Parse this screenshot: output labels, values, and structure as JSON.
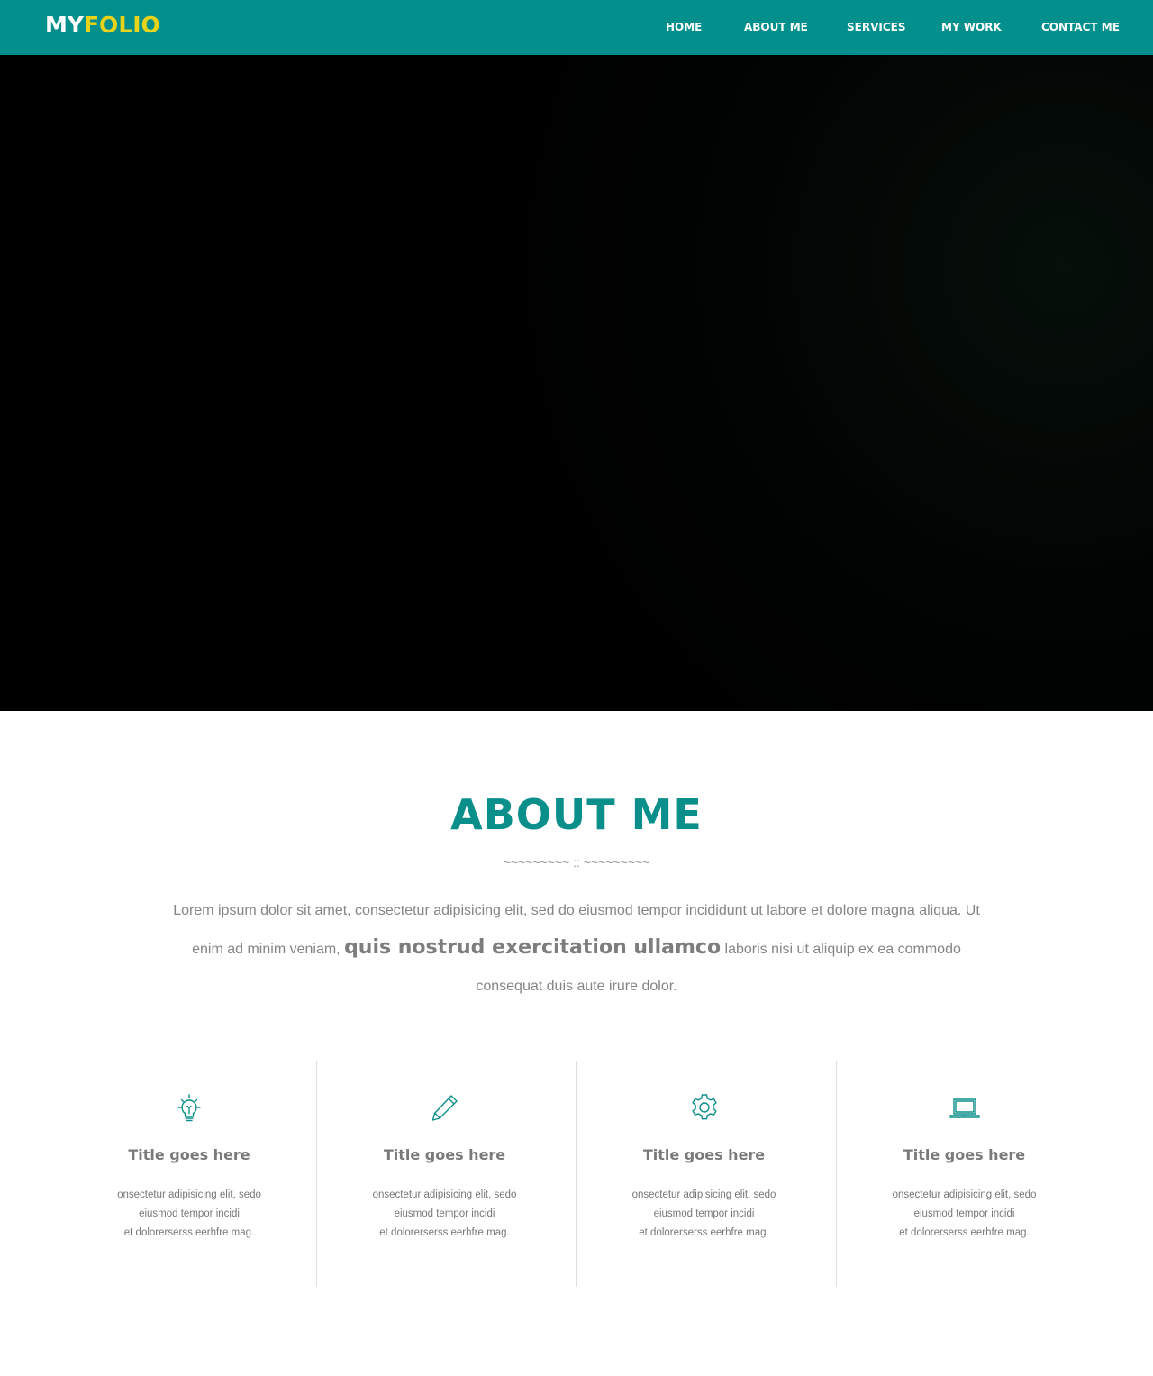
{
  "brand": {
    "part1": "MY",
    "part2": "FOLIO"
  },
  "nav": {
    "items": [
      "HOME",
      "ABOUT ME",
      "SERVICES",
      "MY WORK",
      "CONTACT ME"
    ]
  },
  "about": {
    "title": "ABOUT ME",
    "divider": "~~~~~~~~~ :: ~~~~~~~~~",
    "text_before": "Lorem ipsum dolor sit amet, consectetur adipisicing elit, sed do eiusmod tempor incididunt ut labore et dolore magna aliqua. Ut enim ad minim veniam, ",
    "text_emphasis": "quis nostrud exercitation ullamco",
    "text_after": " laboris nisi ut aliquip ex ea commodo consequat duis aute irure dolor."
  },
  "features": [
    {
      "icon": "lightbulb-icon",
      "title": "Title goes here",
      "lines": [
        "onsectetur adipisicing elit, sedo",
        "eiusmod tempor incidi",
        "et dolorerserss eerhfre mag."
      ]
    },
    {
      "icon": "pencil-icon",
      "title": "Title goes here",
      "lines": [
        "onsectetur adipisicing elit, sedo",
        "eiusmod tempor incidi",
        "et dolorerserss eerhfre mag."
      ]
    },
    {
      "icon": "gear-icon",
      "title": "Title goes here",
      "lines": [
        "onsectetur adipisicing elit, sedo",
        "eiusmod tempor incidi",
        "et dolorerserss eerhfre mag."
      ]
    },
    {
      "icon": "laptop-icon",
      "title": "Title goes here",
      "lines": [
        "onsectetur adipisicing elit, sedo",
        "eiusmod tempor incidi",
        "et dolorerserss eerhfre mag."
      ]
    }
  ],
  "colors": {
    "brand_teal": "#038f8b",
    "accent_yellow": "#e7d31a",
    "heading_teal": "#0a8f8a"
  }
}
